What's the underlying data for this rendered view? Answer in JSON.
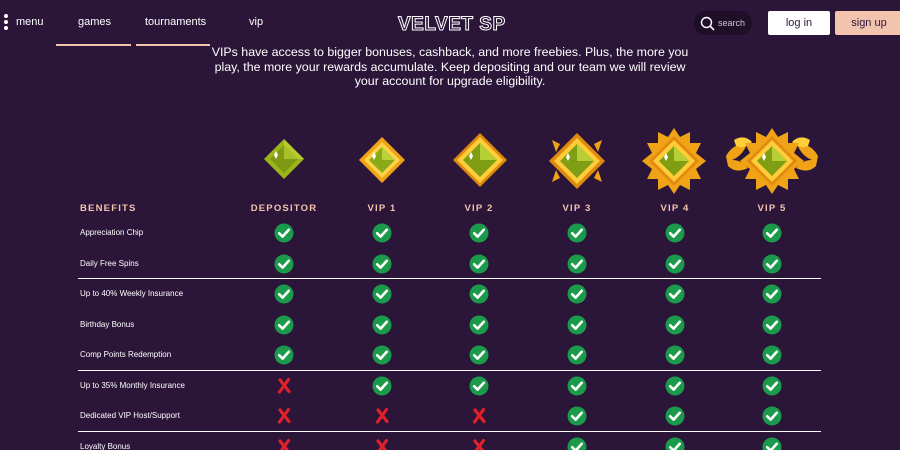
{
  "header": {
    "menu_label": "menu",
    "nav": [
      "games",
      "tournaments",
      "vip"
    ],
    "logo_text": "VELVET SPIN",
    "search_label": "search",
    "login_label": "log in",
    "signup_label": "sign up",
    "accent_color": "#f2c4ad",
    "background_color": "#2b1538"
  },
  "intro": {
    "line1": "VIPs have access to bigger bonuses, cashback, and more freebies. Plus, the more you",
    "line2": "play, the more your rewards accumulate. Keep depositing and our team we will review",
    "line3": "your account for upgrade eligibility."
  },
  "table": {
    "benefits_header": "BENEFITS",
    "tiers": [
      "DEPOSITOR",
      "VIP 1",
      "VIP 2",
      "VIP 3",
      "VIP 4",
      "VIP 5"
    ],
    "rows": [
      {
        "label": "Appreciation Chip",
        "values": [
          true,
          true,
          true,
          true,
          true,
          true
        ]
      },
      {
        "label": "Daily Free Spins",
        "values": [
          true,
          true,
          true,
          true,
          true,
          true
        ]
      },
      {
        "label": "Up to 40% Weekly Insurance",
        "values": [
          true,
          true,
          true,
          true,
          true,
          true
        ]
      },
      {
        "label": "Birthday Bonus",
        "values": [
          true,
          true,
          true,
          true,
          true,
          true
        ]
      },
      {
        "label": "Comp Points Redemption",
        "values": [
          true,
          true,
          true,
          true,
          true,
          true
        ]
      },
      {
        "label": "Up to 35% Monthly Insurance",
        "values": [
          false,
          true,
          true,
          true,
          true,
          true
        ]
      },
      {
        "label": "Dedicated VIP Host/Support",
        "values": [
          false,
          false,
          false,
          true,
          true,
          true
        ]
      },
      {
        "label": "Loyalty Bonus",
        "values": [
          false,
          false,
          false,
          true,
          true,
          true
        ]
      }
    ]
  },
  "icons": {
    "check": "check-circle-icon",
    "cross": "red-x-icon",
    "gem": "green-diamond-badge-icon"
  }
}
